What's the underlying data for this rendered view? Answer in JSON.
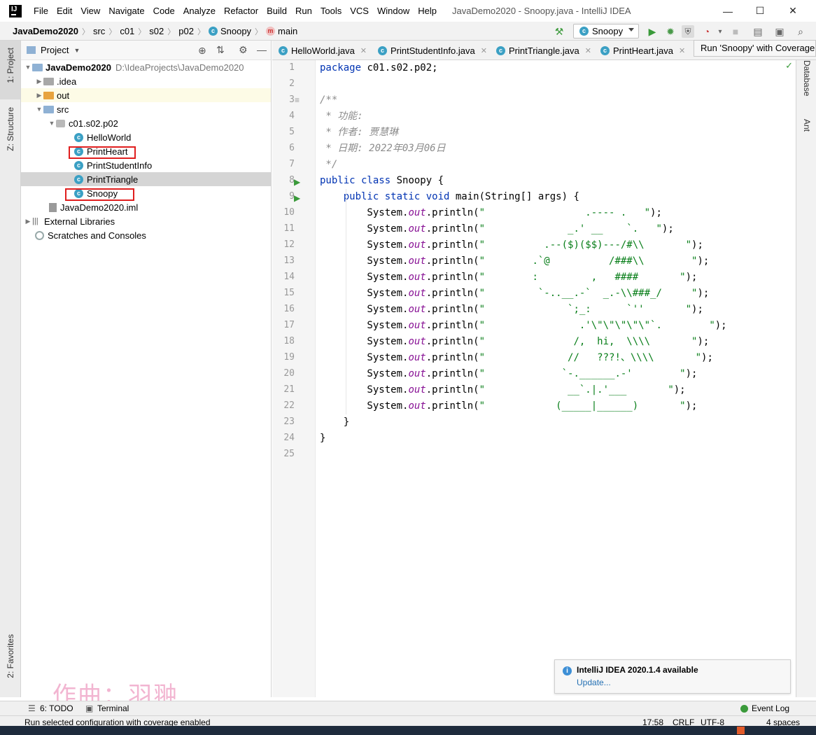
{
  "window": {
    "title": "JavaDemo2020 - Snoopy.java - IntelliJ IDEA",
    "logo_text": "IJ",
    "minimize": "—",
    "maximize": "☐",
    "close": "✕"
  },
  "menu": [
    "File",
    "Edit",
    "View",
    "Navigate",
    "Code",
    "Analyze",
    "Refactor",
    "Build",
    "Run",
    "Tools",
    "VCS",
    "Window",
    "Help"
  ],
  "breadcrumb": [
    "JavaDemo2020",
    "src",
    "c01",
    "s02",
    "p02",
    "Snoopy",
    "main"
  ],
  "toolbar": {
    "run_config": "Snoopy",
    "tooltip": "Run 'Snoopy' with Coverage"
  },
  "left_strip": {
    "project_tab": "1: Project",
    "structure_tab": "Z: Structure",
    "favorites_tab": "2: Favorites"
  },
  "project_panel": {
    "title": "Project",
    "tree": [
      {
        "label": "JavaDemo2020",
        "path": "D:\\IdeaProjects\\JavaDemo2020"
      },
      {
        "label": ".idea"
      },
      {
        "label": "out"
      },
      {
        "label": "src"
      },
      {
        "label": "c01.s02.p02"
      },
      {
        "label": "HelloWorld"
      },
      {
        "label": "PrintHeart"
      },
      {
        "label": "PrintStudentInfo"
      },
      {
        "label": "PrintTriangle"
      },
      {
        "label": "Snoopy"
      },
      {
        "label": "JavaDemo2020.iml"
      },
      {
        "label": "External Libraries"
      },
      {
        "label": "Scratches and Consoles"
      }
    ]
  },
  "editor_tabs": [
    "HelloWorld.java",
    "PrintStudentInfo.java",
    "PrintTriangle.java",
    "PrintHeart.java"
  ],
  "code": {
    "line_numbers": [
      "1",
      "2",
      "3",
      "4",
      "5",
      "6",
      "7",
      "8",
      "9",
      "10",
      "11",
      "12",
      "13",
      "14",
      "15",
      "16",
      "17",
      "18",
      "19",
      "20",
      "21",
      "22",
      "23",
      "24",
      "25"
    ],
    "package_kw": "package",
    "package_name": " c01.s02.p02;",
    "comment_open": "/**",
    "comment_func": " * 功能:",
    "comment_author": " * 作者: 贾慧琳",
    "comment_date": " * 日期: 2022年03月06日",
    "comment_close": " */",
    "class_kw": "public class",
    "class_name": " Snoopy {",
    "main_kw": "    public static void",
    "main_sig": " main(String[] args) {",
    "sys": "        System.",
    "out": "out",
    "println": ".println(",
    "strings": [
      "\"                 .---- .   \"",
      "\"              _.' __    `.   \"",
      "\"          .--($)($$)---/#\\\\       \"",
      "\"        .`@          /###\\\\        \"",
      "\"        :         ,   ####       \"",
      "\"         `-..__.-`  _.-\\\\###_/     \"",
      "\"              `;_:      `''       \"",
      "\"                .'\\\"\\\"\\\"\\\"\\\"`.        \"",
      "\"               /,  hi,  \\\\\\\\       \"",
      "\"              //   ???!、\\\\\\\\       \"",
      "\"             `-.______.-'        \"",
      "\"              __`.|.'___       \"",
      "\"            (_____|______)       \""
    ],
    "tail": ");",
    "close_main": "    }",
    "close_class": "}"
  },
  "right_strip": {
    "database": "Database",
    "ant": "Ant"
  },
  "notification": {
    "title": "IntelliJ IDEA 2020.1.4 available",
    "link": "Update..."
  },
  "bottom_tools": {
    "todo": "6: TODO",
    "terminal": "Terminal",
    "event_log": "Event Log"
  },
  "status": {
    "message": "Run selected configuration with coverage enabled",
    "position": "17:58",
    "line_sep": "CRLF",
    "encoding": "UTF-8",
    "indent": "4 spaces"
  },
  "watermark": "作曲：羽翀"
}
